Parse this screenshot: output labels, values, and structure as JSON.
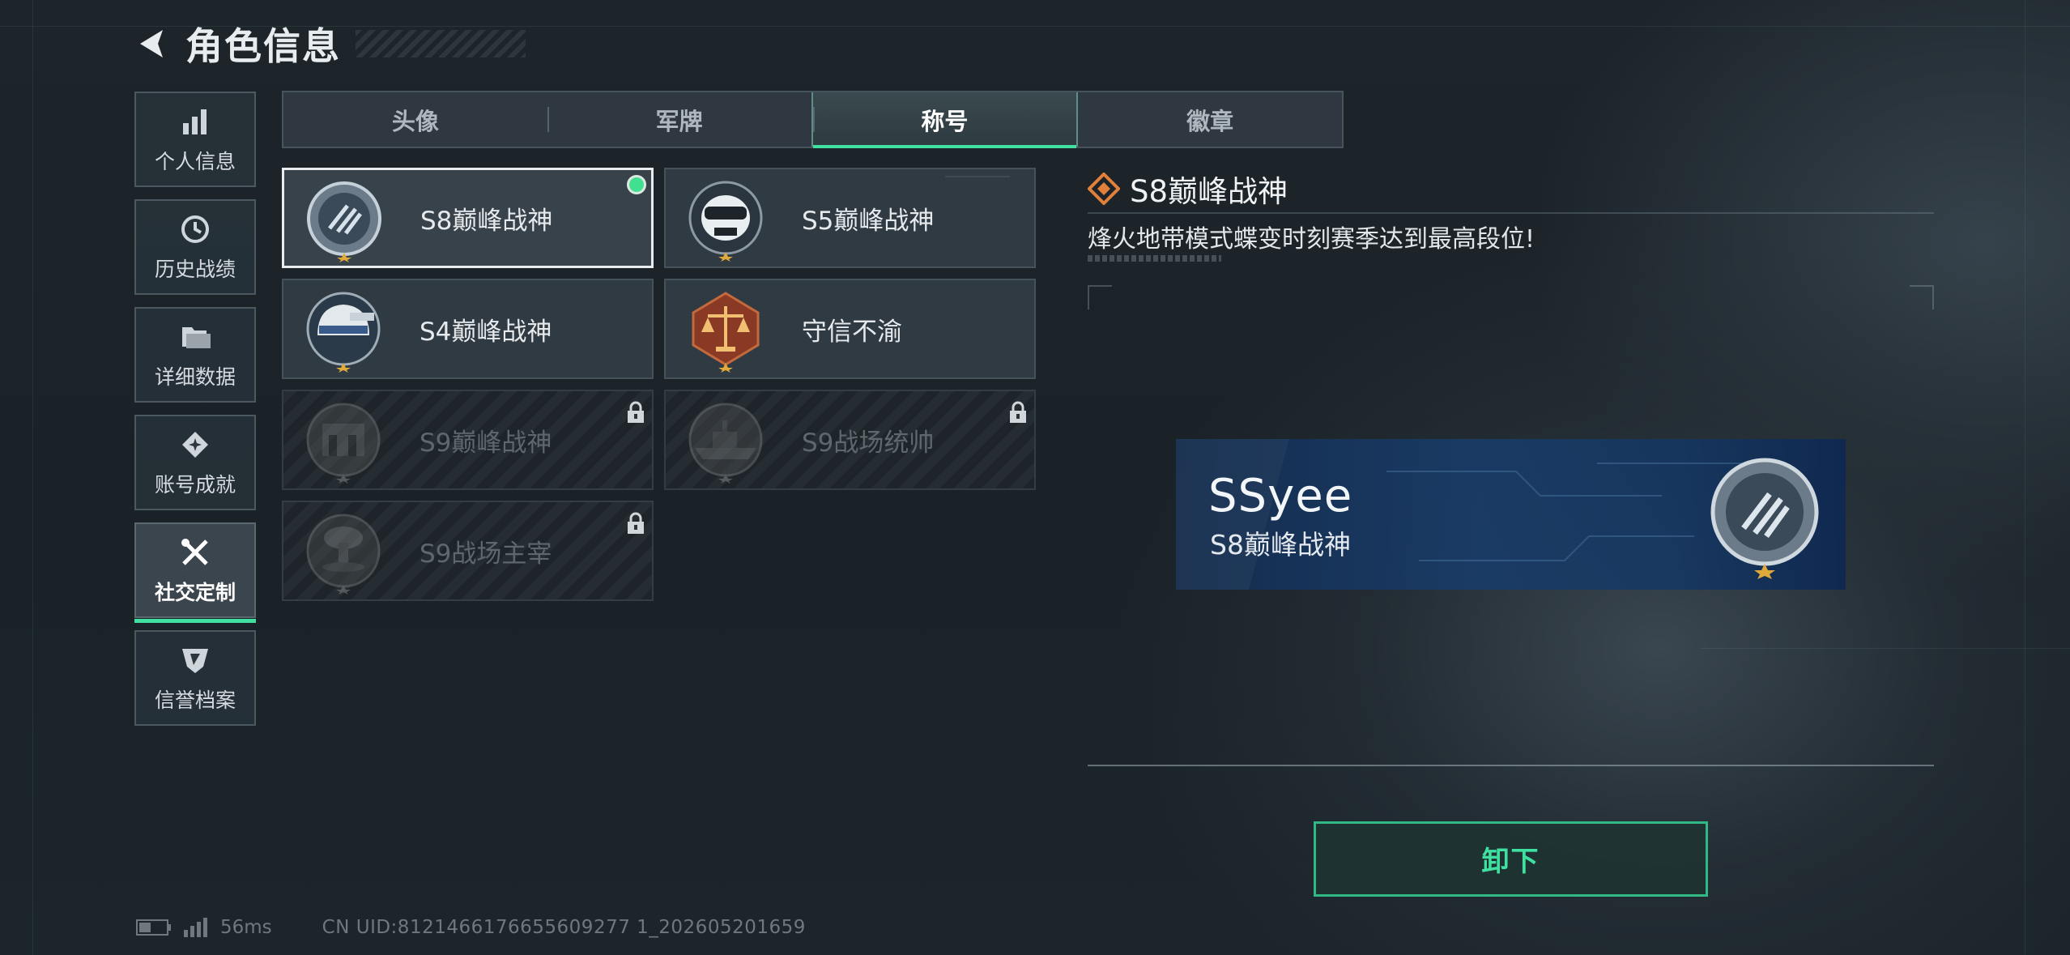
{
  "header": {
    "title": "角色信息"
  },
  "sidebar": {
    "items": [
      {
        "label": "个人信息",
        "icon": "bar-chart-icon",
        "active": false
      },
      {
        "label": "历史战绩",
        "icon": "history-clock-icon",
        "active": false
      },
      {
        "label": "详细数据",
        "icon": "folder-icon",
        "active": false
      },
      {
        "label": "账号成就",
        "icon": "achievement-icon",
        "active": false
      },
      {
        "label": "社交定制",
        "icon": "wrench-screwdriver-icon",
        "active": true
      },
      {
        "label": "信誉档案",
        "icon": "shield-icon",
        "active": false
      }
    ]
  },
  "tabs": [
    {
      "label": "头像",
      "active": false
    },
    {
      "label": "军牌",
      "active": false
    },
    {
      "label": "称号",
      "active": true
    },
    {
      "label": "徽章",
      "active": false
    }
  ],
  "titles": [
    {
      "name": "S8巅峰战神",
      "emblem": "s8-emblem-icon",
      "selected": true,
      "equipped": true,
      "locked": false
    },
    {
      "name": "S5巅峰战神",
      "emblem": "skull-emblem-icon",
      "selected": false,
      "equipped": false,
      "locked": false
    },
    {
      "name": "S4巅峰战神",
      "emblem": "helmet-emblem-icon",
      "selected": false,
      "equipped": false,
      "locked": false
    },
    {
      "name": "守信不渝",
      "emblem": "scales-emblem-icon",
      "selected": false,
      "equipped": false,
      "locked": false
    },
    {
      "name": "S9巅峰战神",
      "emblem": "fortress-emblem-icon",
      "selected": false,
      "equipped": false,
      "locked": true
    },
    {
      "name": "S9战场统帅",
      "emblem": "warship-emblem-icon",
      "selected": false,
      "equipped": false,
      "locked": true
    },
    {
      "name": "S9战场主宰",
      "emblem": "explosion-emblem-icon",
      "selected": false,
      "equipped": false,
      "locked": true
    }
  ],
  "detail": {
    "title": "S8巅峰战神",
    "description": "烽火地带模式蝶变时刻赛季达到最高段位!",
    "preview": {
      "player_name": "SSyee",
      "title": "S8巅峰战神"
    },
    "action_label": "卸下"
  },
  "status_bar": {
    "ping": "56ms",
    "uid": "CN UID:8121466176655609277 1_202605201659"
  },
  "colors": {
    "accent": "#3fe0a0",
    "equipped_dot": "#3fe08f",
    "diamond_icon": "#e0803a",
    "banner_blue": "#1c3c68"
  }
}
